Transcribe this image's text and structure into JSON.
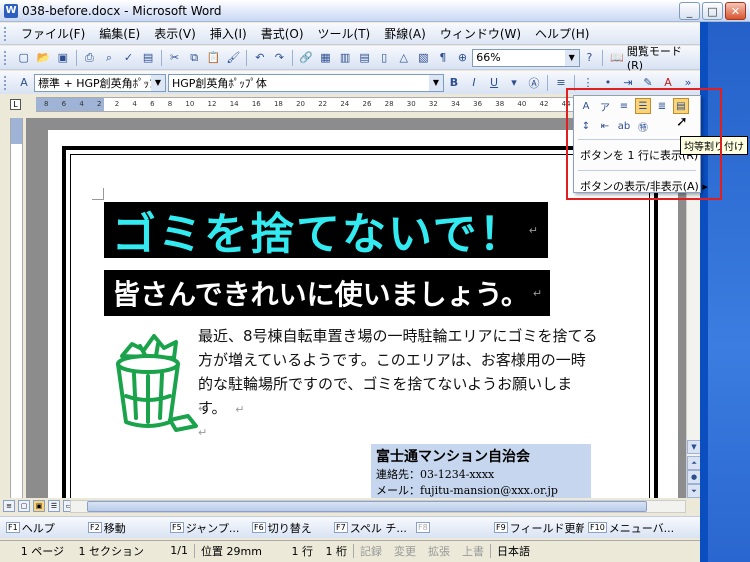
{
  "window": {
    "title": "038-before.docx - Microsoft Word",
    "app_icon": "word-icon",
    "controls": [
      "minimize",
      "maximize",
      "close"
    ]
  },
  "menubar": {
    "items": [
      "ファイル(F)",
      "編集(E)",
      "表示(V)",
      "挿入(I)",
      "書式(O)",
      "ツール(T)",
      "罫線(A)",
      "ウィンドウ(W)",
      "ヘルプ(H)"
    ]
  },
  "standard_toolbar": {
    "zoom": "66%",
    "reading_mode": "閲覧モード(R)"
  },
  "formatting_toolbar": {
    "style": "標準 + HGP創英角ﾎﾟｯﾌﾟ",
    "font": "HGP創英角ﾎﾟｯﾌﾟ体",
    "bold": "B",
    "italic": "I",
    "underline": "U"
  },
  "ruler": {
    "numbers": "8 6 4 2   2 4 6 8 10 12 14 16 18 20 22 24 26 28 30 32 34 36 38 40 42 44 46 48"
  },
  "document": {
    "heading1_part1": "ゴミを",
    "heading1_part2": "捨てないで！",
    "heading2": "皆さんできれいに使いましょう。",
    "body": "最近、8号棟自転車置き場の一時駐輪エリアにゴミを捨てる方が増えているようです。このエリアは、お客様用の一時的な駐輪場所ですので、ゴミを捨てないようお願いします。",
    "para_mark": "↵",
    "sign_org": "富士通マンション自治会",
    "sign_contact": "連絡先：03-1234-xxxx",
    "sign_mail": "メール：fujitu-mansion@xxx.or.jp"
  },
  "popup": {
    "menu_one_row": "ボタンを 1 行に表示(R)",
    "menu_show_hide": "ボタンの表示/非表示(A)",
    "tooltip": "均等割り付け"
  },
  "fkeys": [
    {
      "key": "F1",
      "label": "ヘルプ"
    },
    {
      "key": "F2",
      "label": "移動"
    },
    {
      "key": "F5",
      "label": "ジャンプ..."
    },
    {
      "key": "F6",
      "label": "切り替え"
    },
    {
      "key": "F7",
      "label": "スペル チ..."
    },
    {
      "key": "F8",
      "label": ""
    },
    {
      "key": "F9",
      "label": "フィールド更新"
    },
    {
      "key": "F10",
      "label": "メニューバ..."
    }
  ],
  "statusbar": {
    "page": "1 ページ",
    "section": "1 セクション",
    "pages": "1/1",
    "position": "位置 29mm",
    "line": "1 行",
    "column": "1 桁",
    "rec": "記録",
    "trk": "変更",
    "ext": "拡張",
    "ovr": "上書",
    "lang": "日本語"
  },
  "colors": {
    "heading_cyan": "#33eaf0",
    "highlight_red": "#e02020",
    "trash_green": "#1aa34a"
  }
}
